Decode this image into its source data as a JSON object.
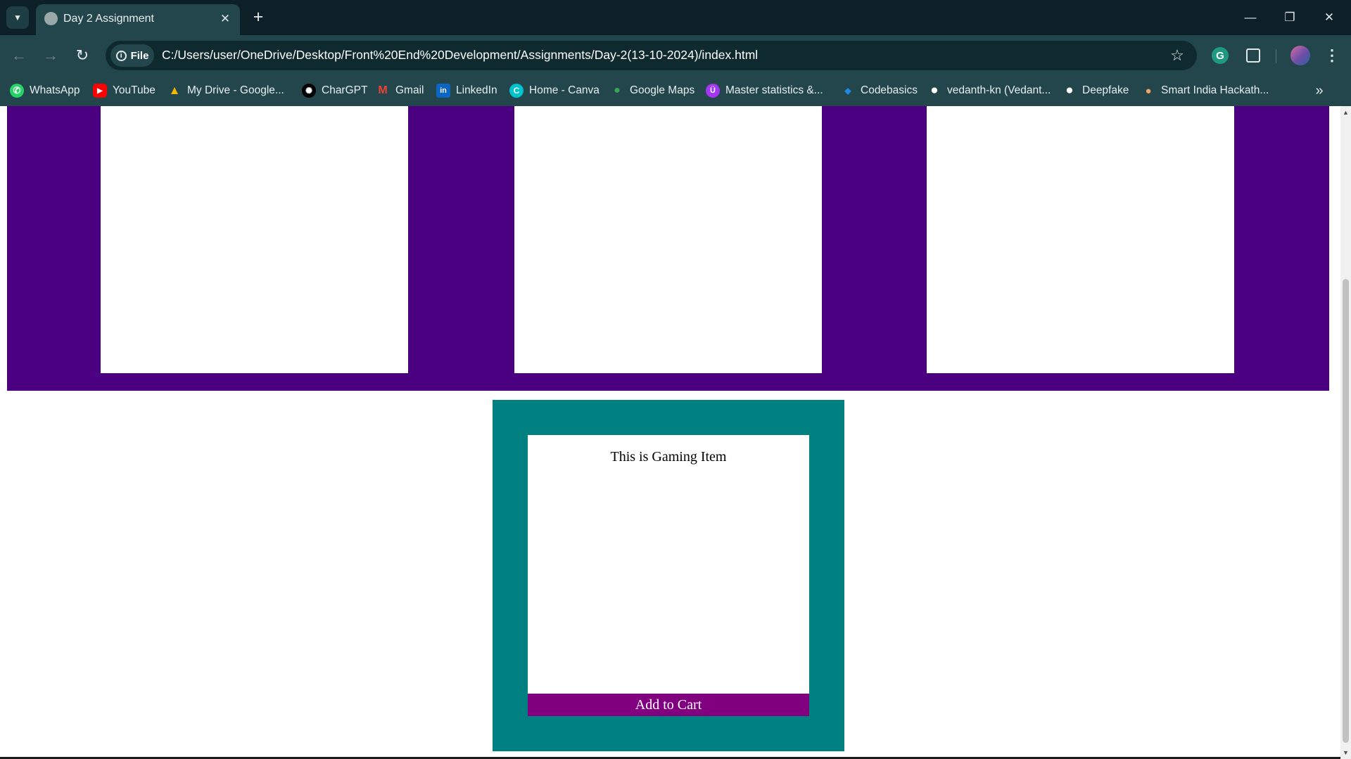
{
  "browser": {
    "tab": {
      "title": "Day 2 Assignment",
      "close_glyph": "✕"
    },
    "new_tab_glyph": "+",
    "window_controls": {
      "minimize": "—",
      "restore": "❐",
      "close": "✕"
    },
    "nav": {
      "back": "←",
      "forward": "→",
      "reload": "↻"
    },
    "omnibox": {
      "chip_label": "File",
      "url": "C:/Users/user/OneDrive/Desktop/Front%20End%20Development/Assignments/Day-2(13-10-2024)/index.html"
    },
    "star_glyph": "☆",
    "menu_glyph": "⋮",
    "bookmarks": [
      {
        "label": "WhatsApp",
        "icon": "whatsapp-icon",
        "color": "#25d366",
        "glyph": "✆"
      },
      {
        "label": "YouTube",
        "icon": "youtube-icon",
        "color": "#ff0000",
        "glyph": "▶"
      },
      {
        "label": "My Drive - Google...",
        "icon": "google-drive-icon",
        "color": "#f4b400",
        "glyph": "▲"
      },
      {
        "label": "CharGPT",
        "icon": "chatgpt-icon",
        "color": "#000000",
        "glyph": "✺"
      },
      {
        "label": "Gmail",
        "icon": "gmail-icon",
        "color": "#ea4335",
        "glyph": "M"
      },
      {
        "label": "LinkedIn",
        "icon": "linkedin-icon",
        "color": "#0a66c2",
        "glyph": "in"
      },
      {
        "label": "Home - Canva",
        "icon": "canva-icon",
        "color": "#00c4cc",
        "glyph": "C"
      },
      {
        "label": "Google Maps",
        "icon": "google-maps-icon",
        "color": "#34a853",
        "glyph": "●"
      },
      {
        "label": "Master statistics &...",
        "icon": "udemy-icon",
        "color": "#a435f0",
        "glyph": "Ü"
      },
      {
        "label": "Codebasics",
        "icon": "codebasics-icon",
        "color": "#1e88e5",
        "glyph": "◆"
      },
      {
        "label": "vedanth-kn (Vedant...",
        "icon": "github-icon",
        "color": "#000000",
        "glyph": "●"
      },
      {
        "label": "Deepfake",
        "icon": "github-icon",
        "color": "#000000",
        "glyph": "●"
      },
      {
        "label": "Smart India Hackath...",
        "icon": "sih-icon",
        "color": "#f4a261",
        "glyph": "●"
      }
    ],
    "bookmarks_overflow_glyph": "»"
  },
  "page": {
    "colors": {
      "band": "#4b0082",
      "teal": "#008080",
      "cart_button": "#800080"
    },
    "product": {
      "text": "This is Gaming Item",
      "button_label": "Add to Cart"
    }
  }
}
